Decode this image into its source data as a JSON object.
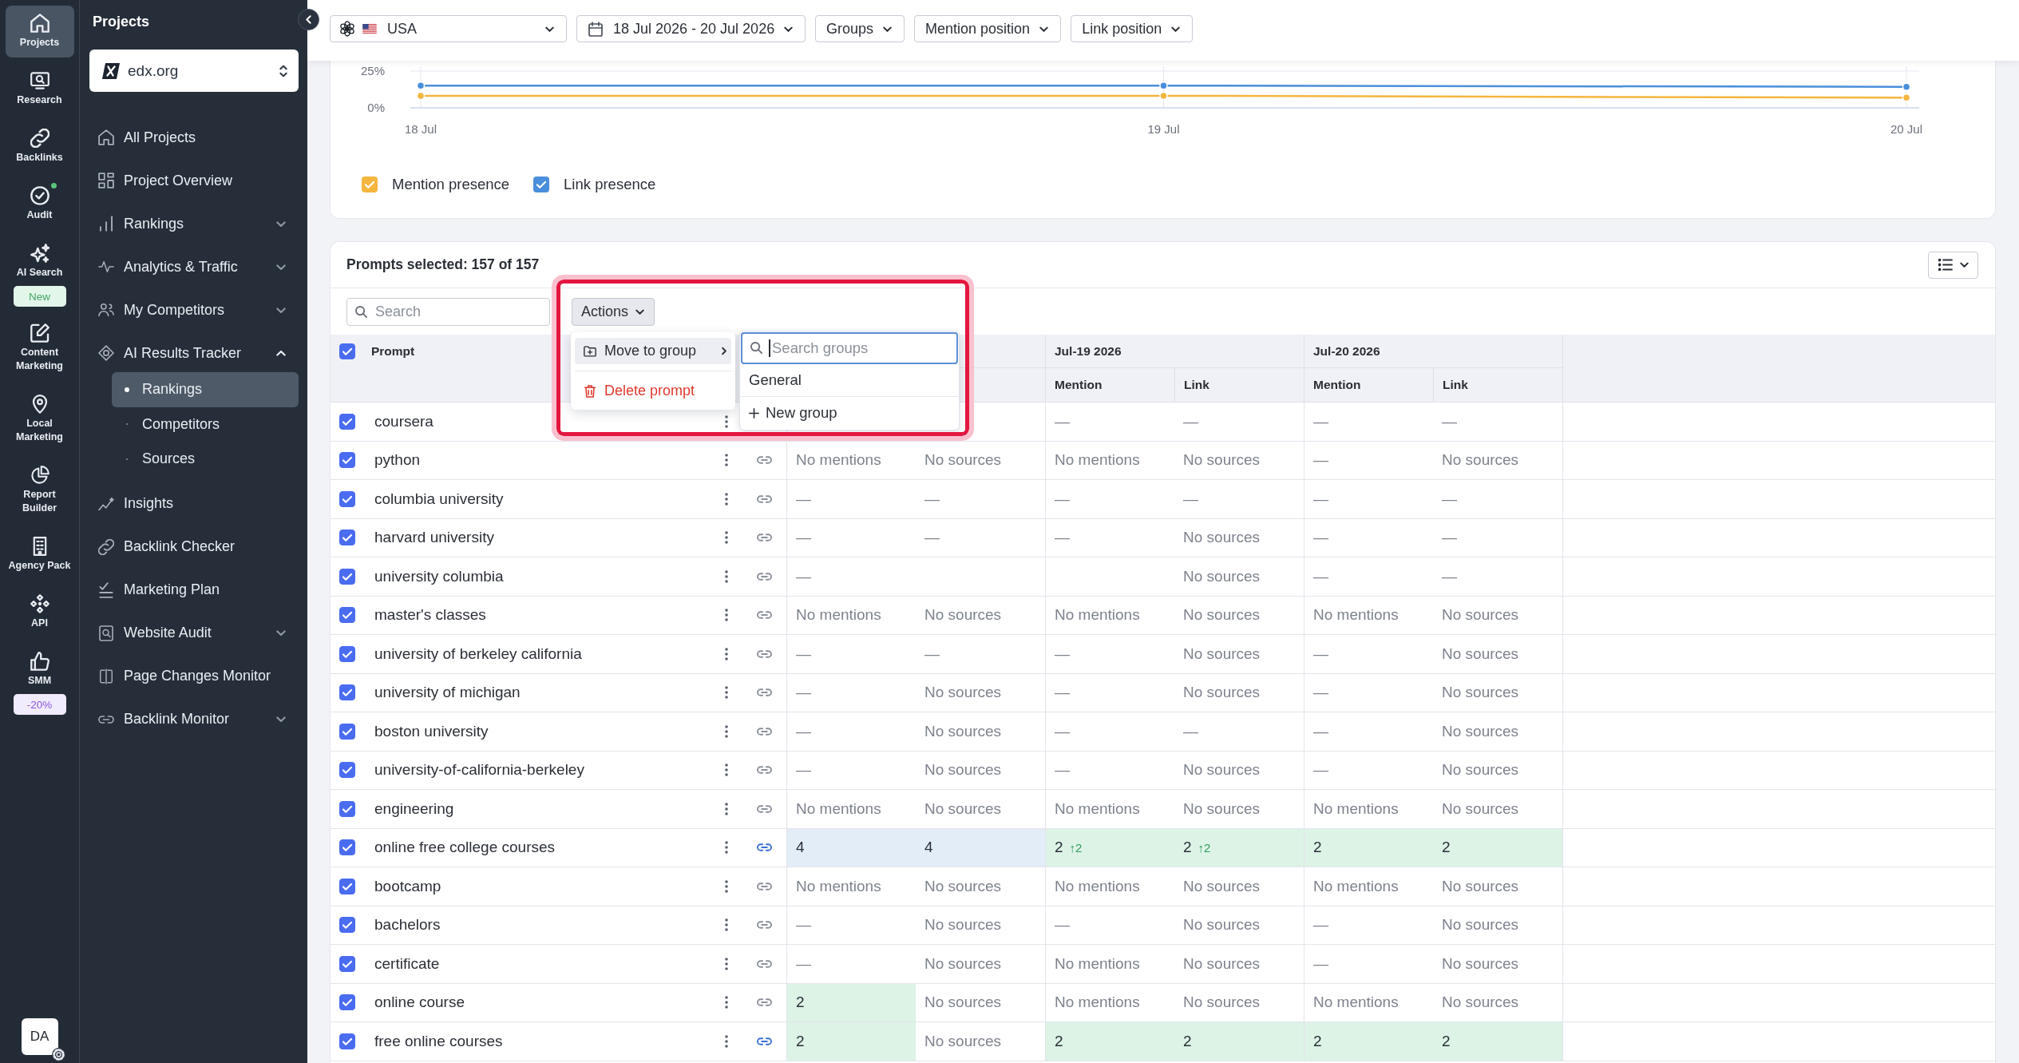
{
  "rail": {
    "items": [
      {
        "label": "Projects",
        "selected": true,
        "notification": false
      },
      {
        "label": "Research",
        "selected": false,
        "notification": false
      },
      {
        "label": "Backlinks",
        "selected": false,
        "notification": false
      },
      {
        "label": "Audit",
        "selected": false,
        "notification": true
      },
      {
        "label": "AI Search",
        "selected": false,
        "notification": false,
        "badge": {
          "text": "New",
          "kind": "new"
        }
      },
      {
        "label": "Content Marketing",
        "selected": false,
        "notification": false
      },
      {
        "label": "Local Marketing",
        "selected": false,
        "notification": false
      },
      {
        "label": "Report Builder",
        "selected": false,
        "notification": false
      },
      {
        "label": "Agency Pack",
        "selected": false,
        "notification": false
      },
      {
        "label": "API",
        "selected": false,
        "notification": false
      },
      {
        "label": "SMM",
        "selected": false,
        "notification": false,
        "badge": {
          "text": "-20%",
          "kind": "discount"
        }
      }
    ],
    "avatar": {
      "initials": "DA"
    }
  },
  "sidebar": {
    "title": "Projects",
    "project": {
      "name": "edx.org"
    },
    "items": [
      {
        "label": "All Projects",
        "selected": false
      },
      {
        "label": "Project Overview",
        "selected": false
      },
      {
        "label": "Rankings",
        "selected": false,
        "expanded": false
      },
      {
        "label": "Analytics & Traffic",
        "selected": false,
        "expanded": false
      },
      {
        "label": "My Competitors",
        "selected": false,
        "expanded": false
      },
      {
        "label": "AI Results Tracker",
        "selected": false,
        "expanded": true,
        "children": [
          {
            "label": "Rankings",
            "selected": true
          },
          {
            "label": "Competitors",
            "selected": false
          },
          {
            "label": "Sources",
            "selected": false
          }
        ]
      },
      {
        "label": "Insights",
        "selected": false
      },
      {
        "label": "Backlink Checker",
        "selected": false
      },
      {
        "label": "Marketing Plan",
        "selected": false
      },
      {
        "label": "Website Audit",
        "selected": false,
        "expanded": false
      },
      {
        "label": "Page Changes Monitor",
        "selected": false
      },
      {
        "label": "Backlink Monitor",
        "selected": false,
        "expanded": false
      }
    ]
  },
  "toolbar": {
    "filters": [
      {
        "kind": "engine",
        "label": "USA"
      },
      {
        "kind": "date",
        "label": "18 Jul 2026 - 20 Jul 2026"
      },
      {
        "kind": "plain",
        "label": "Groups"
      },
      {
        "kind": "plain",
        "label": "Mention position"
      },
      {
        "kind": "plain",
        "label": "Link position"
      }
    ]
  },
  "chart": {
    "chart_data": {
      "type": "line",
      "x": [
        "18 Jul",
        "19 Jul",
        "20 Jul"
      ],
      "ylim": [
        0,
        25
      ],
      "yticks": [
        {
          "value": 0,
          "label": "0%"
        },
        {
          "value": 25,
          "label": "25%"
        }
      ],
      "grid": true,
      "series": [
        {
          "name": "Mention presence",
          "color": "#f4b63f",
          "marker": "circle",
          "values": [
            8.2,
            8.2,
            6.9
          ]
        },
        {
          "name": "Link presence",
          "color": "#4a8fdb",
          "marker": "circle",
          "values": [
            15.1,
            15.1,
            14.3
          ]
        }
      ],
      "legend": true
    },
    "legend_items": [
      {
        "checked": true
      },
      {
        "checked": true
      }
    ]
  },
  "prompts": {
    "title": "Prompts selected: 157 of 157",
    "search": {
      "placeholder": "Search"
    },
    "actions": {
      "label": "Actions",
      "menu": [
        {
          "label": "Move to group",
          "kind": "submenu",
          "selected": true
        },
        {
          "label": "Delete prompt",
          "kind": "danger",
          "selected": false
        }
      ],
      "submenu": {
        "placeholder": "Search groups",
        "groups": [
          {
            "label": "General",
            "selected": false
          }
        ],
        "create": "New group"
      }
    },
    "header": {
      "prompt": "Prompt",
      "checked": true
    },
    "groups": [
      {
        "label": "Jul-19 2026",
        "columns": [
          "Mention",
          "Link"
        ]
      },
      {
        "label": "Jul-20 2026",
        "columns": [
          "Mention",
          "Link"
        ]
      }
    ],
    "rows": [
      {
        "prompt": "coursera",
        "checked": true,
        "cells": [
          "",
          "",
          {
            "text": "—",
            "muted": true
          },
          {
            "text": "—",
            "muted": true
          },
          {
            "text": "—",
            "muted": true
          },
          {
            "text": "—",
            "muted": true
          }
        ]
      },
      {
        "prompt": "python",
        "checked": true,
        "linked": false,
        "cells": [
          {
            "text": "No mentions",
            "muted": true
          },
          {
            "text": "No sources",
            "muted": true
          },
          {
            "text": "No mentions",
            "muted": true
          },
          {
            "text": "No sources",
            "muted": true
          },
          {
            "text": "—",
            "muted": true
          },
          {
            "text": "No sources",
            "muted": true
          }
        ]
      },
      {
        "prompt": "columbia university",
        "checked": true,
        "linked": false,
        "cells": [
          {
            "text": "—",
            "muted": true
          },
          {
            "text": "—",
            "muted": true
          },
          {
            "text": "—",
            "muted": true
          },
          {
            "text": "—",
            "muted": true
          },
          {
            "text": "—",
            "muted": true
          },
          {
            "text": "—",
            "muted": true
          }
        ]
      },
      {
        "prompt": "harvard university",
        "checked": true,
        "linked": false,
        "cells": [
          {
            "text": "—",
            "muted": true
          },
          {
            "text": "—",
            "muted": true
          },
          {
            "text": "—",
            "muted": true
          },
          {
            "text": "No sources",
            "muted": true
          },
          {
            "text": "—",
            "muted": true
          },
          {
            "text": "—",
            "muted": true
          }
        ]
      },
      {
        "prompt": "university columbia",
        "checked": true,
        "linked": false,
        "cells": [
          {
            "text": "—",
            "muted": true
          },
          "",
          "",
          {
            "text": "No sources",
            "muted": true
          },
          {
            "text": "—",
            "muted": true
          },
          {
            "text": "—",
            "muted": true
          }
        ]
      },
      {
        "prompt": "master's classes",
        "checked": true,
        "linked": false,
        "cells": [
          {
            "text": "No mentions",
            "muted": true
          },
          {
            "text": "No sources",
            "muted": true
          },
          {
            "text": "No mentions",
            "muted": true
          },
          {
            "text": "No sources",
            "muted": true
          },
          {
            "text": "No mentions",
            "muted": true
          },
          {
            "text": "No sources",
            "muted": true
          }
        ]
      },
      {
        "prompt": "university of berkeley california",
        "checked": true,
        "linked": false,
        "cells": [
          {
            "text": "—",
            "muted": true
          },
          {
            "text": "—",
            "muted": true
          },
          {
            "text": "—",
            "muted": true
          },
          {
            "text": "No sources",
            "muted": true
          },
          {
            "text": "—",
            "muted": true
          },
          {
            "text": "No sources",
            "muted": true
          }
        ]
      },
      {
        "prompt": "university of michigan",
        "checked": true,
        "linked": false,
        "cells": [
          {
            "text": "—",
            "muted": true
          },
          {
            "text": "No sources",
            "muted": true
          },
          {
            "text": "—",
            "muted": true
          },
          {
            "text": "No sources",
            "muted": true
          },
          {
            "text": "—",
            "muted": true
          },
          {
            "text": "No sources",
            "muted": true
          }
        ]
      },
      {
        "prompt": "boston university",
        "checked": true,
        "linked": false,
        "cells": [
          {
            "text": "—",
            "muted": true
          },
          {
            "text": "No sources",
            "muted": true
          },
          {
            "text": "—",
            "muted": true
          },
          {
            "text": "—",
            "muted": true
          },
          {
            "text": "—",
            "muted": true
          },
          {
            "text": "No sources",
            "muted": true
          }
        ]
      },
      {
        "prompt": "university-of-california-berkeley",
        "checked": true,
        "linked": false,
        "cells": [
          {
            "text": "—",
            "muted": true
          },
          {
            "text": "No sources",
            "muted": true
          },
          {
            "text": "—",
            "muted": true
          },
          {
            "text": "No sources",
            "muted": true
          },
          {
            "text": "—",
            "muted": true
          },
          {
            "text": "No sources",
            "muted": true
          }
        ]
      },
      {
        "prompt": "engineering",
        "checked": true,
        "linked": false,
        "cells": [
          {
            "text": "No mentions",
            "muted": true
          },
          {
            "text": "No sources",
            "muted": true
          },
          {
            "text": "No mentions",
            "muted": true
          },
          {
            "text": "No sources",
            "muted": true
          },
          {
            "text": "No mentions",
            "muted": true
          },
          {
            "text": "No sources",
            "muted": true
          }
        ]
      },
      {
        "prompt": "online free college courses",
        "checked": true,
        "linked": true,
        "cells": [
          {
            "text": "4",
            "muted": false,
            "color": "#e3edf8"
          },
          {
            "text": "4",
            "muted": false,
            "color": "#e3edf8"
          },
          {
            "text": "2",
            "change": "↑2",
            "muted": false,
            "color": "#dcf3e6"
          },
          {
            "text": "2",
            "change": "↑2",
            "muted": false,
            "color": "#dcf3e6"
          },
          {
            "text": "2",
            "muted": false,
            "color": "#dcf3e6"
          },
          {
            "text": "2",
            "muted": false,
            "color": "#dcf3e6"
          }
        ]
      },
      {
        "prompt": "bootcamp",
        "checked": true,
        "linked": false,
        "cells": [
          {
            "text": "No mentions",
            "muted": true
          },
          {
            "text": "No sources",
            "muted": true
          },
          {
            "text": "No mentions",
            "muted": true
          },
          {
            "text": "No sources",
            "muted": true
          },
          {
            "text": "No mentions",
            "muted": true
          },
          {
            "text": "No sources",
            "muted": true
          }
        ]
      },
      {
        "prompt": "bachelors",
        "checked": true,
        "linked": false,
        "cells": [
          {
            "text": "—",
            "muted": true
          },
          {
            "text": "No sources",
            "muted": true
          },
          {
            "text": "—",
            "muted": true
          },
          {
            "text": "No sources",
            "muted": true
          },
          {
            "text": "—",
            "muted": true
          },
          {
            "text": "No sources",
            "muted": true
          }
        ]
      },
      {
        "prompt": "certificate",
        "checked": true,
        "linked": false,
        "cells": [
          {
            "text": "—",
            "muted": true
          },
          {
            "text": "No sources",
            "muted": true
          },
          {
            "text": "No mentions",
            "muted": true
          },
          {
            "text": "No sources",
            "muted": true
          },
          {
            "text": "—",
            "muted": true
          },
          {
            "text": "No sources",
            "muted": true
          }
        ]
      },
      {
        "prompt": "online course",
        "checked": true,
        "linked": false,
        "cells": [
          {
            "text": "2",
            "muted": false,
            "color": "#dcf3e6"
          },
          {
            "text": "No sources",
            "muted": true
          },
          {
            "text": "No mentions",
            "muted": true
          },
          {
            "text": "No sources",
            "muted": true
          },
          {
            "text": "No mentions",
            "muted": true
          },
          {
            "text": "No sources",
            "muted": true
          }
        ]
      },
      {
        "prompt": "free online courses",
        "checked": true,
        "linked": true,
        "cells": [
          {
            "text": "2",
            "muted": false,
            "color": "#dcf3e6"
          },
          {
            "text": "No sources",
            "muted": true
          },
          {
            "text": "2",
            "muted": false,
            "color": "#dcf3e6"
          },
          {
            "text": "2",
            "muted": false,
            "color": "#dcf3e6"
          },
          {
            "text": "2",
            "muted": false,
            "color": "#dcf3e6"
          },
          {
            "text": "2",
            "muted": false,
            "color": "#dcf3e6"
          }
        ]
      }
    ]
  }
}
